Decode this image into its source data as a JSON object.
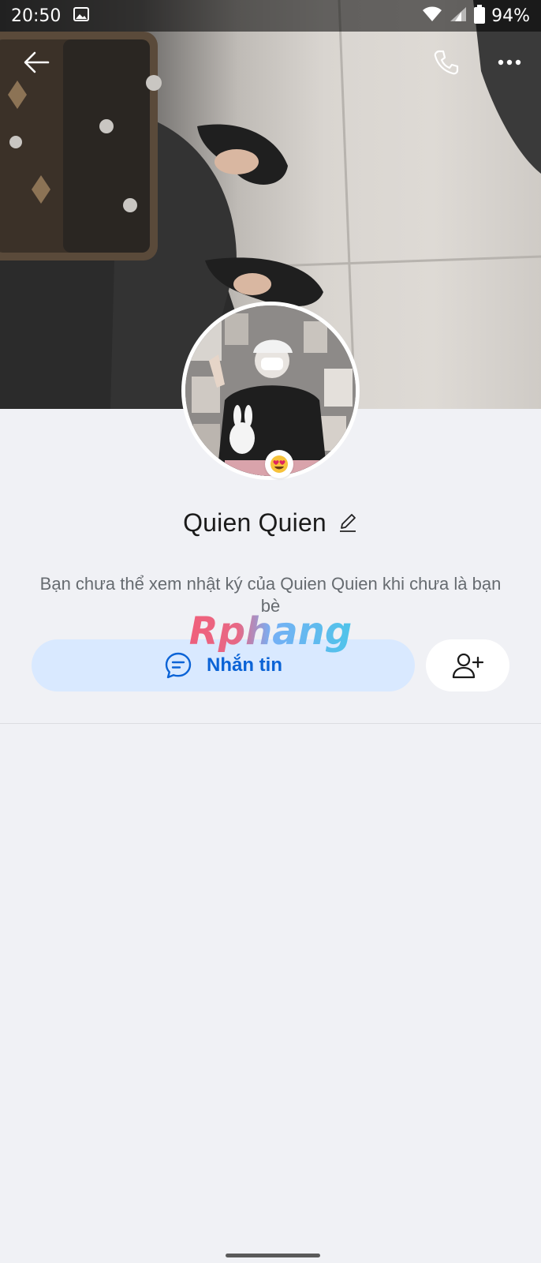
{
  "status_bar": {
    "time": "20:50",
    "battery": "94%",
    "icons": [
      "gallery-icon",
      "wifi-icon",
      "cell-signal-icon",
      "battery-icon"
    ]
  },
  "topbar": {
    "icons": [
      "back-arrow-icon",
      "phone-icon",
      "more-dots-icon"
    ]
  },
  "profile": {
    "name": "Quien Quien",
    "notice": "Bạn chưa thể xem nhật ký của Quien Quien khi chưa là bạn bè",
    "avatar_badge": "heart-eyes-emoji-icon"
  },
  "watermark": {
    "text": "Rphang"
  },
  "actions": {
    "message_label": "Nhắn tin",
    "add_friend_icon": "add-friend-icon"
  },
  "colors": {
    "accent": "#0b63d6",
    "message_bg": "#d9e9ff",
    "page_bg": "#f0f1f5"
  }
}
